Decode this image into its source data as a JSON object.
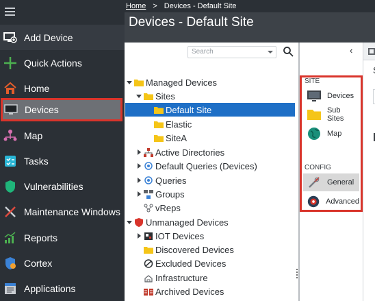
{
  "sidebar": {
    "items": [
      {
        "label": "Add Device",
        "icon": "add-device-icon"
      },
      {
        "label": "Quick Actions",
        "icon": "plus-icon"
      },
      {
        "label": "Home",
        "icon": "home-icon"
      },
      {
        "label": "Devices",
        "icon": "monitor-icon",
        "active": true
      },
      {
        "label": "Map",
        "icon": "map-icon"
      },
      {
        "label": "Tasks",
        "icon": "tasks-icon"
      },
      {
        "label": "Vulnerabilities",
        "icon": "shield-icon"
      },
      {
        "label": "Maintenance Windows",
        "icon": "tools-icon"
      },
      {
        "label": "Reports",
        "icon": "reports-icon"
      },
      {
        "label": "Cortex",
        "icon": "cortex-icon"
      },
      {
        "label": "Applications",
        "icon": "applications-icon"
      }
    ]
  },
  "header": {
    "breadcrumb_home": "Home",
    "breadcrumb_sep": ">",
    "breadcrumb_current": "Devices - Default Site",
    "title": "Devices - Default Site"
  },
  "search": {
    "placeholder": "Search"
  },
  "tree": [
    {
      "label": "Managed Devices",
      "icon": "folder-icon"
    },
    {
      "label": "Sites",
      "icon": "folder-icon"
    },
    {
      "label": "Default Site",
      "icon": "folder-icon",
      "selected": true
    },
    {
      "label": "Elastic",
      "icon": "folder-icon"
    },
    {
      "label": "SiteA",
      "icon": "folder-icon"
    },
    {
      "label": "Active Directories",
      "icon": "network-icon"
    },
    {
      "label": "Default Queries (Devices)",
      "icon": "query-icon"
    },
    {
      "label": "Queries",
      "icon": "query-icon"
    },
    {
      "label": "Groups",
      "icon": "groups-icon"
    },
    {
      "label": "vReps",
      "icon": "vreps-icon"
    },
    {
      "label": "Unmanaged Devices",
      "icon": "shield-red-icon"
    },
    {
      "label": "IOT Devices",
      "icon": "iot-icon"
    },
    {
      "label": "Discovered Devices",
      "icon": "folder-icon"
    },
    {
      "label": "Excluded Devices",
      "icon": "excluded-icon"
    },
    {
      "label": "Infrastructure",
      "icon": "infrastructure-icon"
    },
    {
      "label": "Archived Devices",
      "icon": "archived-icon"
    }
  ],
  "site_panel": {
    "site_label": "SITE",
    "config_label": "CONFIG",
    "site_items": [
      {
        "label": "Devices",
        "icon": "monitor-icon"
      },
      {
        "label": "Sub Sites",
        "icon": "folder-icon"
      },
      {
        "label": "Map",
        "icon": "globe-icon"
      }
    ],
    "config_items": [
      {
        "label": "General",
        "icon": "wrench-icon",
        "highlighted": true
      },
      {
        "label": "Advanced",
        "icon": "advanced-icon"
      }
    ]
  },
  "right_panel": {
    "heading_fragment": "S"
  },
  "colors": {
    "sidebar_bg": "#2b3036",
    "title_bg": "#3d4248",
    "selected_blue": "#1e6fc6",
    "highlight_red": "#d9342b",
    "folder_yellow": "#f5c518"
  }
}
